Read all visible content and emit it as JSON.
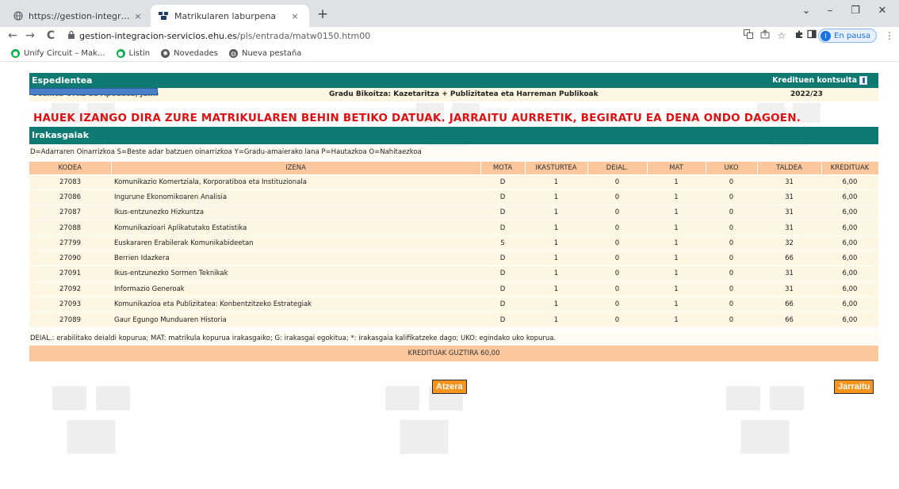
{
  "browser": {
    "tabs": [
      {
        "title": "https://gestion-integracion-servi",
        "close": "×"
      },
      {
        "title": "Matrikularen laburpena",
        "close": "×"
      }
    ],
    "new_tab": "+",
    "window_controls": {
      "chevron": "⌄",
      "minimize": "–",
      "restore": "❐",
      "close": "✕"
    },
    "nav": {
      "back": "←",
      "forward": "→",
      "reload": "C"
    },
    "url": {
      "host": "gestion-integracion-servicios.ehu.es",
      "path": "/pls/entrada/matw0150.htm00"
    },
    "profile": {
      "initial": "I",
      "label": "En pausa"
    },
    "menu": "⋮",
    "bookmarks": [
      {
        "label": "Unify Circuit – Mak...",
        "icon": "circle-icon",
        "color": "#0bb14b"
      },
      {
        "label": "Listin",
        "icon": "circle-icon",
        "color": "#0bb14b"
      },
      {
        "label": "Novedades",
        "icon": "gear-icon",
        "color": "#555555"
      },
      {
        "label": "Nueva pestaña",
        "icon": "globe-icon",
        "color": "#555555"
      }
    ]
  },
  "page": {
    "expedientea_title": "Espedientea",
    "kreditu_link": "Kredituen kontsulta",
    "student_name": "Ocunica Ortiz de Apodaca, Jaime",
    "degree": "Gradu Bikoitza: Kazetaritza + Publizitatea eta Harreman Publikoak",
    "year": "2022/23",
    "headline": "HAUEK IZANGO DIRA ZURE MATRIKULAREN BEHIN BETIKO DATUAK. JARRAITU AURRETIK, BEGIRATU EA DENA ONDO DAGOEN.",
    "subjects_title": "Irakasgaiak",
    "legend": "D=Adarraren Oinarrizkoa S=Beste adar batzuen oinarrizkoa Y=Gradu-amaierako lana P=Hautazkoa O=Nahitaezkoa",
    "columns": [
      "KODEA",
      "IZENA",
      "MOTA",
      "IKASTURTEA",
      "DEIAL.",
      "MAT",
      "UKO",
      "TALDEA",
      "KREDITUAK"
    ],
    "rows": [
      [
        "27083",
        "Komunikazio Komertziala, Korporatiboa eta Instituzionala",
        "D",
        "1",
        "0",
        "1",
        "0",
        "31",
        "6,00"
      ],
      [
        "27086",
        "Ingurune Ekonomikoaren Analisia",
        "D",
        "1",
        "0",
        "1",
        "0",
        "31",
        "6,00"
      ],
      [
        "27087",
        "Ikus-entzunezko Hizkuntza",
        "D",
        "1",
        "0",
        "1",
        "0",
        "31",
        "6,00"
      ],
      [
        "27088",
        "Komunikazioari Aplikatutako Estatistika",
        "D",
        "1",
        "0",
        "1",
        "0",
        "31",
        "6,00"
      ],
      [
        "27799",
        "Euskararen Erabilerak Komunikabideetan",
        "S",
        "1",
        "0",
        "1",
        "0",
        "32",
        "6,00"
      ],
      [
        "27090",
        "Berrien Idazkera",
        "D",
        "1",
        "0",
        "1",
        "0",
        "66",
        "6,00"
      ],
      [
        "27091",
        "Ikus-entzunezko Sormen Teknikak",
        "D",
        "1",
        "0",
        "1",
        "0",
        "31",
        "6,00"
      ],
      [
        "27092",
        "Informazio Generoak",
        "D",
        "1",
        "0",
        "1",
        "0",
        "31",
        "6,00"
      ],
      [
        "27093",
        "Komunikazioa eta Publizitatea: Konbentzitzeko Estrategiak",
        "D",
        "1",
        "0",
        "1",
        "0",
        "66",
        "6,00"
      ],
      [
        "27089",
        "Gaur Egungo Munduaren Historia",
        "D",
        "1",
        "0",
        "1",
        "0",
        "66",
        "6,00"
      ]
    ],
    "footnote": "DEIAL.: erabilitako deialdi kopurua; MAT: matrikula kopurua irakasgaiko; G: irakasgai egokitua; *: irakasgaia kalifikatzeke dago; UKO: egindako uko kopurua.",
    "total": "KREDITUAK GUZTIRA 60,00",
    "back_button": "Atzera",
    "continue_button": "Jarraitu"
  },
  "colors": {
    "header_teal": "#0f7a72",
    "header_orange": "#fbc89e",
    "row_bg": "#fdf6e3",
    "headline_red": "#e01010",
    "button_orange": "#f7941d"
  }
}
